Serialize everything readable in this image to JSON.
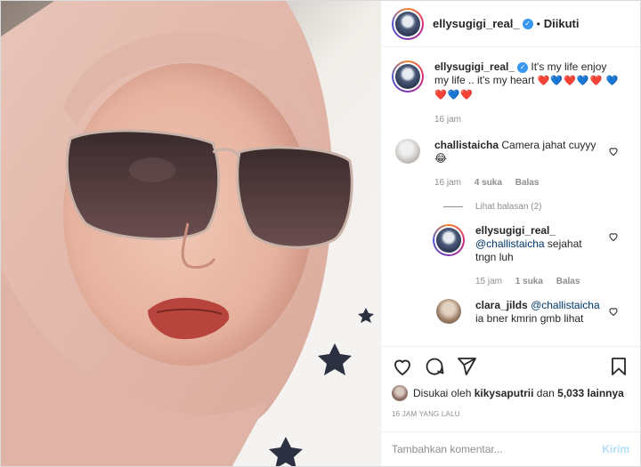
{
  "post": {
    "username": "ellysugigi_real_",
    "follow_state": "Diikuti",
    "dot": "•",
    "caption": "It's my life enjoy my life .. it's my heart",
    "caption_emojis_1": "❤️💙❤️💙❤️",
    "caption_emojis_2": "💙❤️💙❤️",
    "caption_time": "16 jam"
  },
  "comments": [
    {
      "username": "challistaicha",
      "text": "Camera jahat cuyyy",
      "emoji": "😂",
      "time": "16 jam",
      "likes": "4 suka",
      "reply": "Balas",
      "view_replies": "Lihat balasan (2)"
    },
    {
      "username": "ellysugigi_real_",
      "mention": "@challistaicha",
      "text": "sejahat tngn luh",
      "time": "15 jam",
      "likes": "1 suka",
      "reply": "Balas"
    },
    {
      "username": "clara_jilds",
      "mention": "@challistaicha",
      "text": "ia bner kmrin gmb lihat"
    }
  ],
  "likes": {
    "prefix": "Disukai oleh",
    "user": "kikysaputrii",
    "connector": "dan",
    "others": "5,033 lainnya"
  },
  "timestamp": "16 JAM YANG LALU",
  "add_comment": {
    "placeholder": "Tambahkan komentar...",
    "post_label": "Kirim"
  },
  "icons": {
    "verified": "verified-badge-icon",
    "heart": "heart-icon",
    "comment": "comment-icon",
    "share": "share-icon",
    "bookmark": "bookmark-icon"
  },
  "colors": {
    "link": "#00376b",
    "verified": "#3897f0",
    "muted": "#8e8e8e",
    "post_disabled": "#b2dffc"
  }
}
